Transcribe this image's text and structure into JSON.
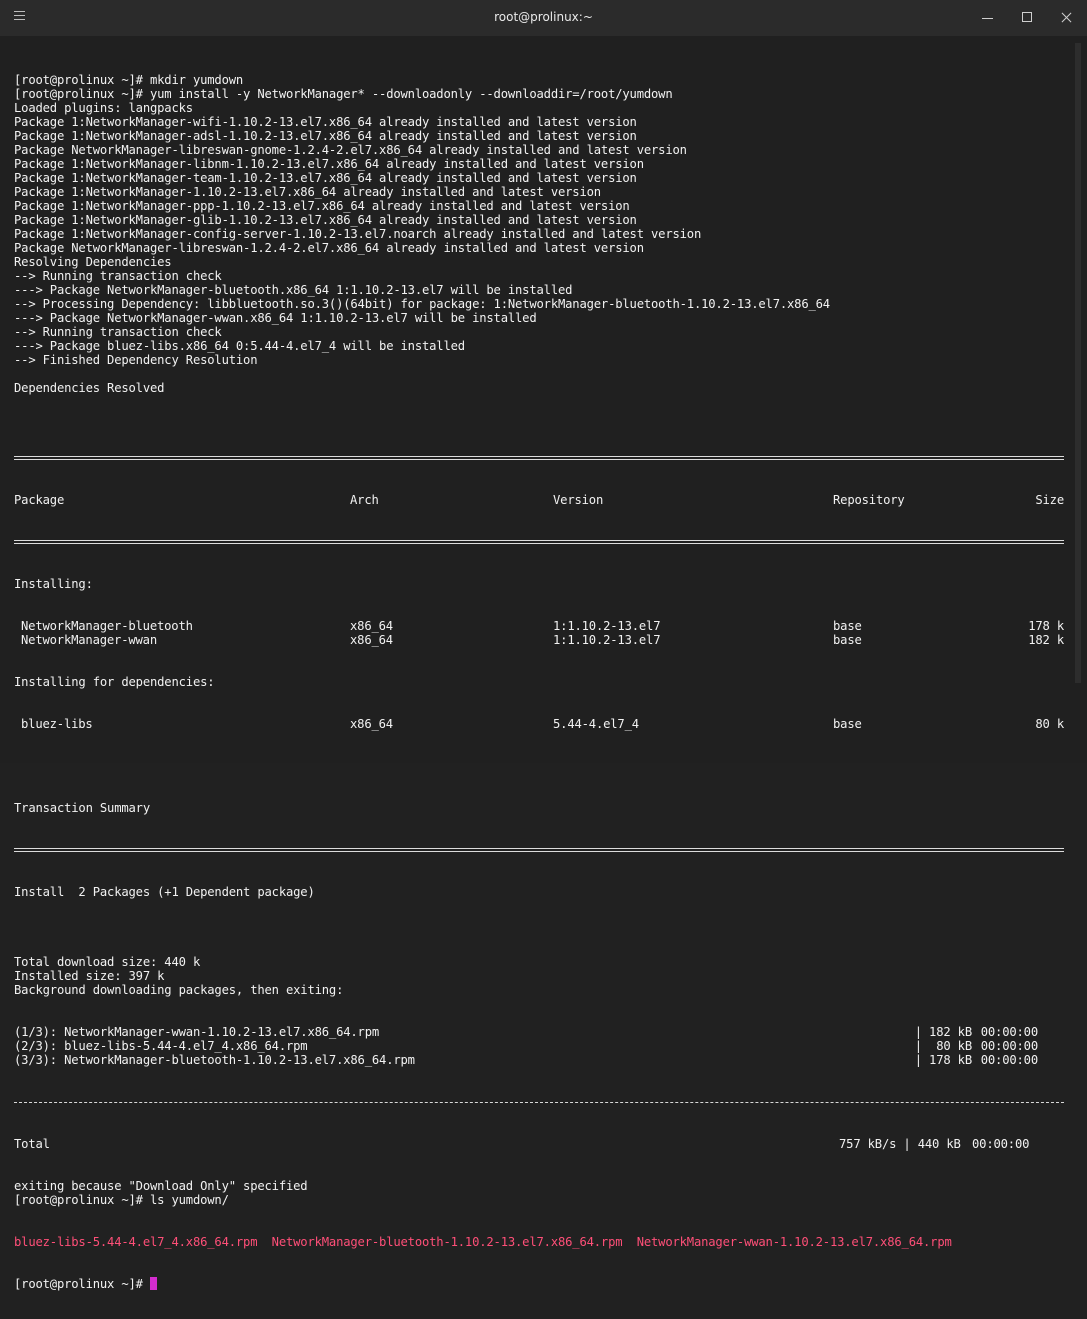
{
  "window": {
    "title": "root@prolinux:~"
  },
  "terminal": {
    "lines_top": [
      "[root@prolinux ~]# mkdir yumdown",
      "[root@prolinux ~]# yum install -y NetworkManager* --downloadonly --downloaddir=/root/yumdown",
      "Loaded plugins: langpacks",
      "Package 1:NetworkManager-wifi-1.10.2-13.el7.x86_64 already installed and latest version",
      "Package 1:NetworkManager-adsl-1.10.2-13.el7.x86_64 already installed and latest version",
      "Package NetworkManager-libreswan-gnome-1.2.4-2.el7.x86_64 already installed and latest version",
      "Package 1:NetworkManager-libnm-1.10.2-13.el7.x86_64 already installed and latest version",
      "Package 1:NetworkManager-team-1.10.2-13.el7.x86_64 already installed and latest version",
      "Package 1:NetworkManager-1.10.2-13.el7.x86_64 already installed and latest version",
      "Package 1:NetworkManager-ppp-1.10.2-13.el7.x86_64 already installed and latest version",
      "Package 1:NetworkManager-glib-1.10.2-13.el7.x86_64 already installed and latest version",
      "Package 1:NetworkManager-config-server-1.10.2-13.el7.noarch already installed and latest version",
      "Package NetworkManager-libreswan-1.2.4-2.el7.x86_64 already installed and latest version",
      "Resolving Dependencies",
      "--> Running transaction check",
      "---> Package NetworkManager-bluetooth.x86_64 1:1.10.2-13.el7 will be installed",
      "--> Processing Dependency: libbluetooth.so.3()(64bit) for package: 1:NetworkManager-bluetooth-1.10.2-13.el7.x86_64",
      "---> Package NetworkManager-wwan.x86_64 1:1.10.2-13.el7 will be installed",
      "--> Running transaction check",
      "---> Package bluez-libs.x86_64 0:5.44-4.el7_4 will be installed",
      "--> Finished Dependency Resolution",
      "",
      "Dependencies Resolved",
      ""
    ],
    "table": {
      "headers": [
        "Package",
        "Arch",
        "Version",
        "Repository",
        "Size"
      ],
      "installing_label": "Installing:",
      "installing": [
        [
          "NetworkManager-bluetooth",
          "x86_64",
          "1:1.10.2-13.el7",
          "base",
          "178 k"
        ],
        [
          "NetworkManager-wwan",
          "x86_64",
          "1:1.10.2-13.el7",
          "base",
          "182 k"
        ]
      ],
      "deps_label": "Installing for dependencies:",
      "deps": [
        [
          "bluez-libs",
          "x86_64",
          "5.44-4.el7_4",
          "base",
          "80 k"
        ]
      ],
      "summary": "Transaction Summary",
      "install_line": "Install  2 Packages (+1 Dependent package)"
    },
    "after": [
      "",
      "Total download size: 440 k",
      "Installed size: 397 k",
      "Background downloading packages, then exiting:"
    ],
    "downloads": [
      [
        "(1/3): NetworkManager-wwan-1.10.2-13.el7.x86_64.rpm",
        "| 182 kB",
        "00:00:00"
      ],
      [
        "(2/3): bluez-libs-5.44-4.el7_4.x86_64.rpm",
        "|  80 kB",
        "00:00:00"
      ],
      [
        "(3/3): NetworkManager-bluetooth-1.10.2-13.el7.x86_64.rpm",
        "| 178 kB",
        "00:00:00"
      ]
    ],
    "total": [
      "Total",
      "757 kB/s | 440 kB",
      "00:00:00"
    ],
    "tail": [
      "exiting because \"Download Only\" specified",
      "[root@prolinux ~]# ls yumdown/"
    ],
    "ls_output": "bluez-libs-5.44-4.el7_4.x86_64.rpm  NetworkManager-bluetooth-1.10.2-13.el7.x86_64.rpm  NetworkManager-wwan-1.10.2-13.el7.x86_64.rpm",
    "prompt": "[root@prolinux ~]# ",
    "colors": {
      "background": "#202020",
      "text": "#f2f2f2",
      "ls_files": "#ff4f78",
      "cursor": "#d42ccf"
    }
  }
}
